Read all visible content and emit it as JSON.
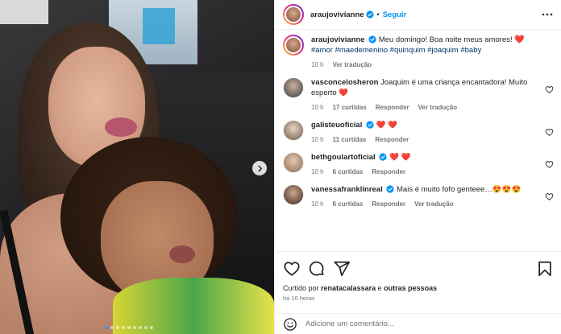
{
  "post": {
    "author": "araujovivianne",
    "follow_label": "Seguir",
    "separator": "•",
    "caption_text": "Meu domingo! Boa noite meus amores!",
    "caption_heart": "❤️",
    "hashtags": "#amor #maedemenino #quinquim #joaquim #baby",
    "caption_meta": {
      "time": "10 h",
      "see_translation": "Ver tradução"
    }
  },
  "comments": [
    {
      "user": "vasconcelosheron",
      "verified": false,
      "text": "Joaquim é uma criança encantadora! Muito esperto ❤️",
      "time": "10 h",
      "likes": "17 curtidas",
      "reply": "Responder",
      "translate": "Ver tradução"
    },
    {
      "user": "galisteuoficial",
      "verified": true,
      "text": "❤️ ❤️",
      "time": "10 h",
      "likes": "11 curtidas",
      "reply": "Responder",
      "translate": ""
    },
    {
      "user": "bethgoulartoficial",
      "verified": true,
      "text": "❤️ ❤️",
      "time": "10 h",
      "likes": "6 curtidas",
      "reply": "Responder",
      "translate": ""
    },
    {
      "user": "vanessafranklinreal",
      "verified": true,
      "text": "Mais é muito fofo genteee…😍😍😍",
      "time": "10 h",
      "likes": "6 curtidas",
      "reply": "Responder",
      "translate": "Ver tradução"
    }
  ],
  "footer": {
    "liked_prefix": "Curtido por",
    "liked_user": "renatacalassara",
    "liked_suffix": "e",
    "liked_others": "outras pessoas",
    "time_ago": "há 10 horas",
    "comment_placeholder": "Adicione um comentário..."
  },
  "carousel": {
    "total_slides": 9,
    "current_slide": 1
  },
  "colors": {
    "link_blue": "#0095f6",
    "heart_red": "#ed1c2e",
    "hashtag": "#00376b",
    "muted": "#737373"
  },
  "icons": [
    "more-options-icon",
    "verified-badge-icon",
    "heart-icon",
    "comment-icon",
    "share-icon",
    "save-icon",
    "emoji-icon",
    "next-arrow-icon"
  ]
}
